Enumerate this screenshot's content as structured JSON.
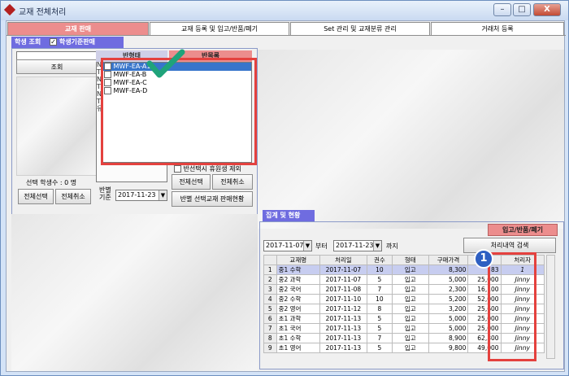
{
  "window": {
    "title": "교재 전체처리",
    "minimize": "–",
    "maximize": "□",
    "close": "X"
  },
  "tabs": [
    {
      "label": "교재 판매"
    },
    {
      "label": "교재 등록 및 입고/반품/폐기"
    },
    {
      "label": "Set 관리 및 교재분류 관리"
    },
    {
      "label": "거래처 등록"
    }
  ],
  "student": {
    "header": "학생 조회",
    "checkbox_label": "학생기준판매",
    "search_button": "조회",
    "count_label": "선택 학생수 : 0 명",
    "select_all": "전체선택",
    "deselect_all": "전체취소",
    "side_letters": [
      "N",
      "T",
      "N",
      "T",
      "N",
      "T",
      "유"
    ]
  },
  "class_panel": {
    "col_class": "반형태",
    "col_repeat": "반목록",
    "classes": [
      {
        "name": "MWF-EA-A1",
        "selected": true
      },
      {
        "name": "MWF-EA-B",
        "selected": false
      },
      {
        "name": "MWF-EA-C",
        "selected": false
      },
      {
        "name": "MWF-EA-D",
        "selected": false
      }
    ],
    "exclude_label": "반선택시 휴원생 제외",
    "select_all": "전체선택",
    "deselect_all": "전체취소",
    "base_label": "반별\n기준",
    "base_date": "2017-11-23",
    "status_button": "반별 선택교재 판매현황"
  },
  "summary": {
    "header": "집계 및 현황",
    "action_label": "입고/반품/폐기",
    "from_date": "2017-11-07",
    "from_suffix": "부터",
    "to_date": "2017-11-23",
    "to_suffix": "까지",
    "search_button": "처리내역 검색",
    "columns": [
      "",
      "교재명",
      "처리일",
      "권수",
      "형태",
      "구매가격",
      "",
      "처리자"
    ],
    "rows": [
      [
        "1",
        "중1 수학",
        "2017-11-07",
        "10",
        "입고",
        "8,300",
        "83",
        "1"
      ],
      [
        "2",
        "중2 과학",
        "2017-11-07",
        "5",
        "입고",
        "5,000",
        "25,000",
        "Jinny"
      ],
      [
        "3",
        "중2 국어",
        "2017-11-08",
        "7",
        "입고",
        "2,300",
        "16,100",
        "Jinny"
      ],
      [
        "4",
        "중2 수학",
        "2017-11-10",
        "10",
        "입고",
        "5,200",
        "52,000",
        "Jinny"
      ],
      [
        "5",
        "중2 영어",
        "2017-11-12",
        "8",
        "입고",
        "3,200",
        "25,600",
        "Jinny"
      ],
      [
        "6",
        "초1 과학",
        "2017-11-13",
        "5",
        "입고",
        "5,000",
        "25,000",
        "Jinny"
      ],
      [
        "7",
        "초1 국어",
        "2017-11-13",
        "5",
        "입고",
        "5,000",
        "25,000",
        "Jinny"
      ],
      [
        "8",
        "초1 수학",
        "2017-11-13",
        "7",
        "입고",
        "8,900",
        "62,300",
        "Jinny"
      ],
      [
        "9",
        "초1 영어",
        "2017-11-13",
        "5",
        "입고",
        "9,800",
        "49,000",
        "Jinny"
      ]
    ],
    "marker": "1"
  },
  "colors": {
    "active_tab": "#ec8d8d",
    "header": "#6f6ce0",
    "highlight": "#e4413e",
    "check": "#1fa37a"
  }
}
